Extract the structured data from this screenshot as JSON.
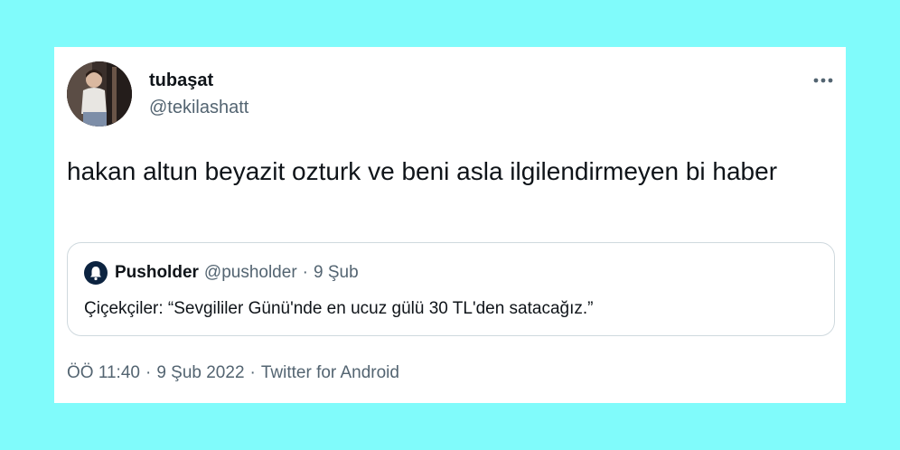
{
  "tweet": {
    "display_name": "tubaşat",
    "handle": "@tekilashatt",
    "text": "hakan altun beyazit ozturk ve beni asla ilgilendirmeyen bi haber",
    "time": "ÖÖ 11:40",
    "date": "9 Şub 2022",
    "source": "Twitter for Android",
    "separator": "·",
    "more_icon": "more-horizontal-icon"
  },
  "quote": {
    "name": "Pusholder",
    "handle": "@pusholder",
    "separator": "·",
    "date": "9 Şub",
    "text": "Çiçekçiler: “Sevgililer Günü'nde en ucuz gülü 30 TL'den satacağız.”",
    "avatar_icon": "bell-icon"
  },
  "colors": {
    "background": "#80fbfb",
    "card": "#ffffff",
    "primary_text": "#0f1419",
    "secondary_text": "#536471",
    "border": "#cfd9de"
  }
}
